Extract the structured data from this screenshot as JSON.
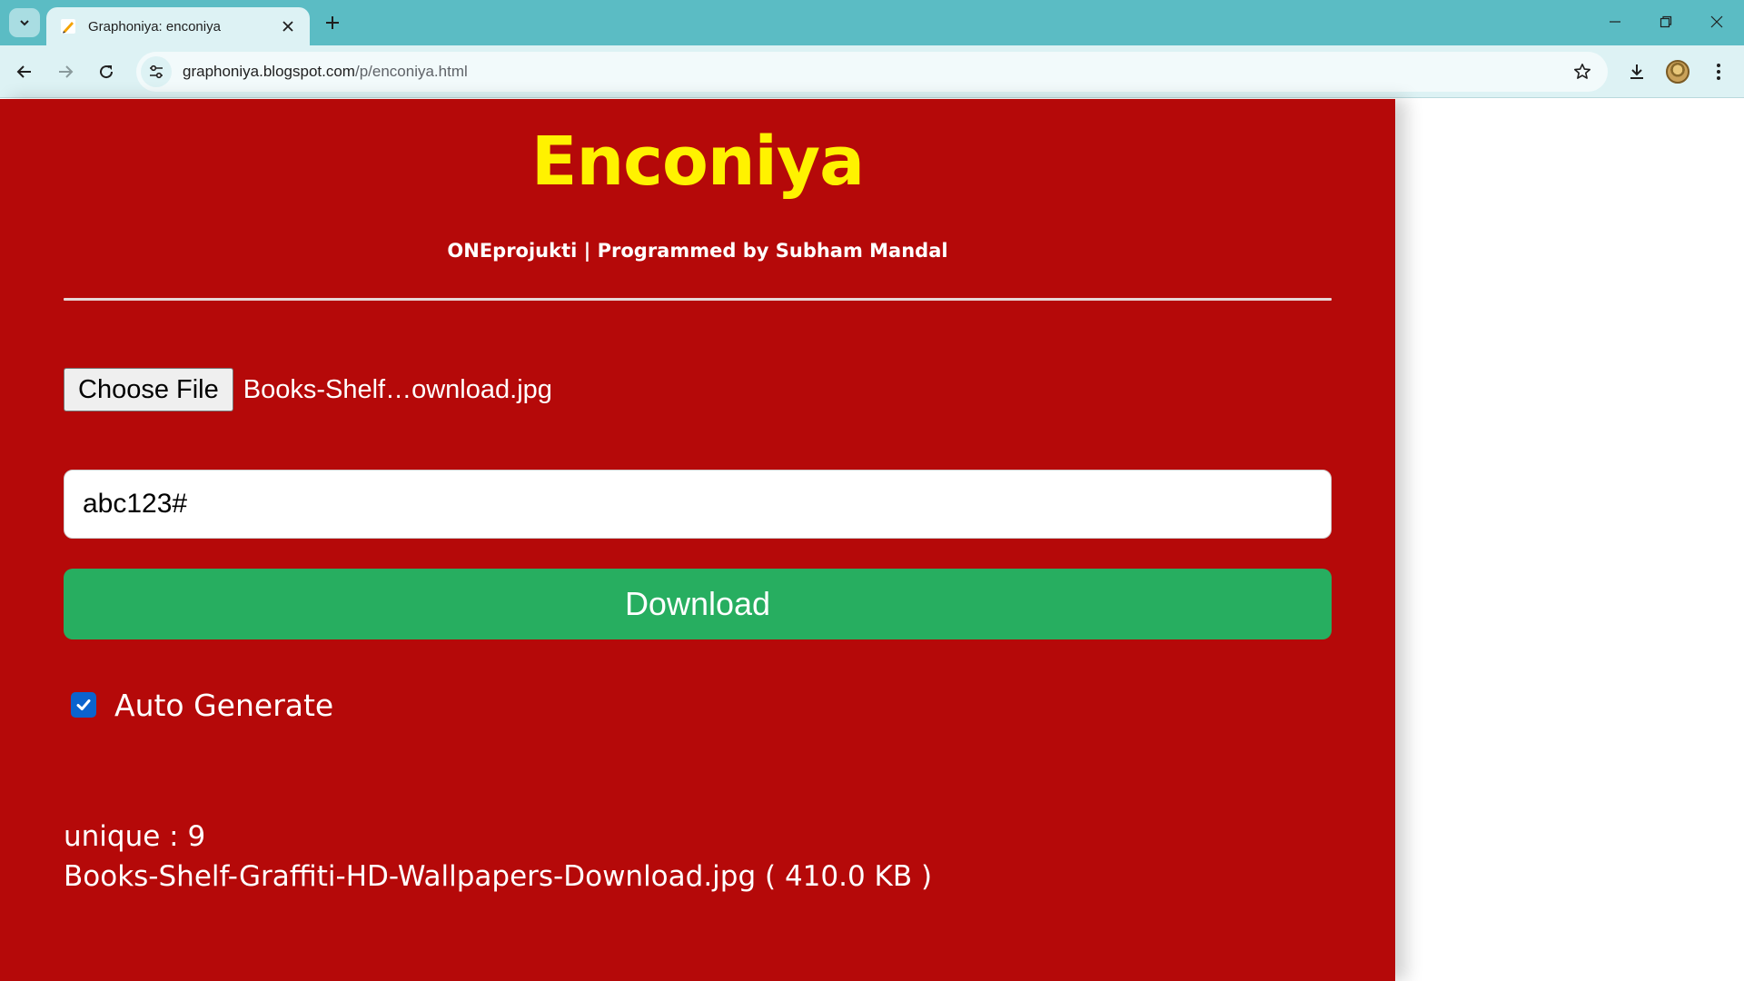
{
  "browser": {
    "tab_title": "Graphoniya: enconiya",
    "url_domain": "graphoniya.blogspot.com",
    "url_path": "/p/enconiya.html"
  },
  "icons": {
    "tab_search": "chevron-down-icon",
    "favicon": "pencil-icon",
    "close": "close-icon",
    "new_tab": "plus-icon",
    "back": "arrow-left-icon",
    "forward": "arrow-right-icon",
    "reload": "reload-icon",
    "site_info": "tune-icon",
    "bookmark": "star-icon",
    "download": "download-icon",
    "menu": "kebab-menu-icon"
  },
  "colors": {
    "panel": "#b50909",
    "title": "#fff200",
    "download_button": "#27ae60",
    "checkbox": "#0b63ce"
  },
  "app": {
    "title": "Enconiya",
    "subtitle": "ONEprojukti | Programmed by Subham Mandal",
    "choose_file_label": "Choose File",
    "file_name": "Books-Shelf…ownload.jpg",
    "password_value": "abc123#",
    "download_label": "Download",
    "auto_generate_label": "Auto Generate",
    "auto_generate_checked": true,
    "unique_text": "unique : 9",
    "file_info": "Books-Shelf-Graffiti-HD-Wallpapers-Download.jpg ( 410.0 KB )"
  }
}
